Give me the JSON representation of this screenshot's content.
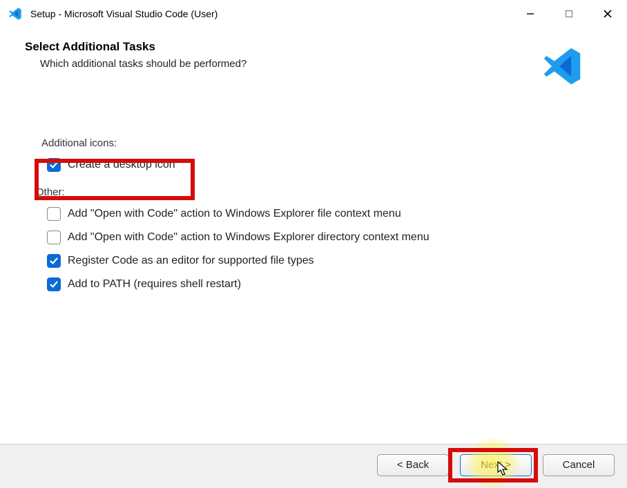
{
  "titlebar": {
    "title": "Setup - Microsoft Visual Studio Code (User)"
  },
  "page": {
    "heading": "Select Additional Tasks",
    "subheading": "Which additional tasks should be performed?"
  },
  "groups": {
    "icons_label": "Additional icons:",
    "other_label": "Other:"
  },
  "options": {
    "desktop_icon": {
      "label": "Create a desktop icon",
      "checked": true
    },
    "open_file_ctx": {
      "label": "Add \"Open with Code\" action to Windows Explorer file context menu",
      "checked": false
    },
    "open_dir_ctx": {
      "label": "Add \"Open with Code\" action to Windows Explorer directory context menu",
      "checked": false
    },
    "register_editor": {
      "label": "Register Code as an editor for supported file types",
      "checked": true
    },
    "add_to_path": {
      "label": "Add to PATH (requires shell restart)",
      "checked": true
    }
  },
  "buttons": {
    "back": "< Back",
    "next": "Next >",
    "cancel": "Cancel"
  }
}
